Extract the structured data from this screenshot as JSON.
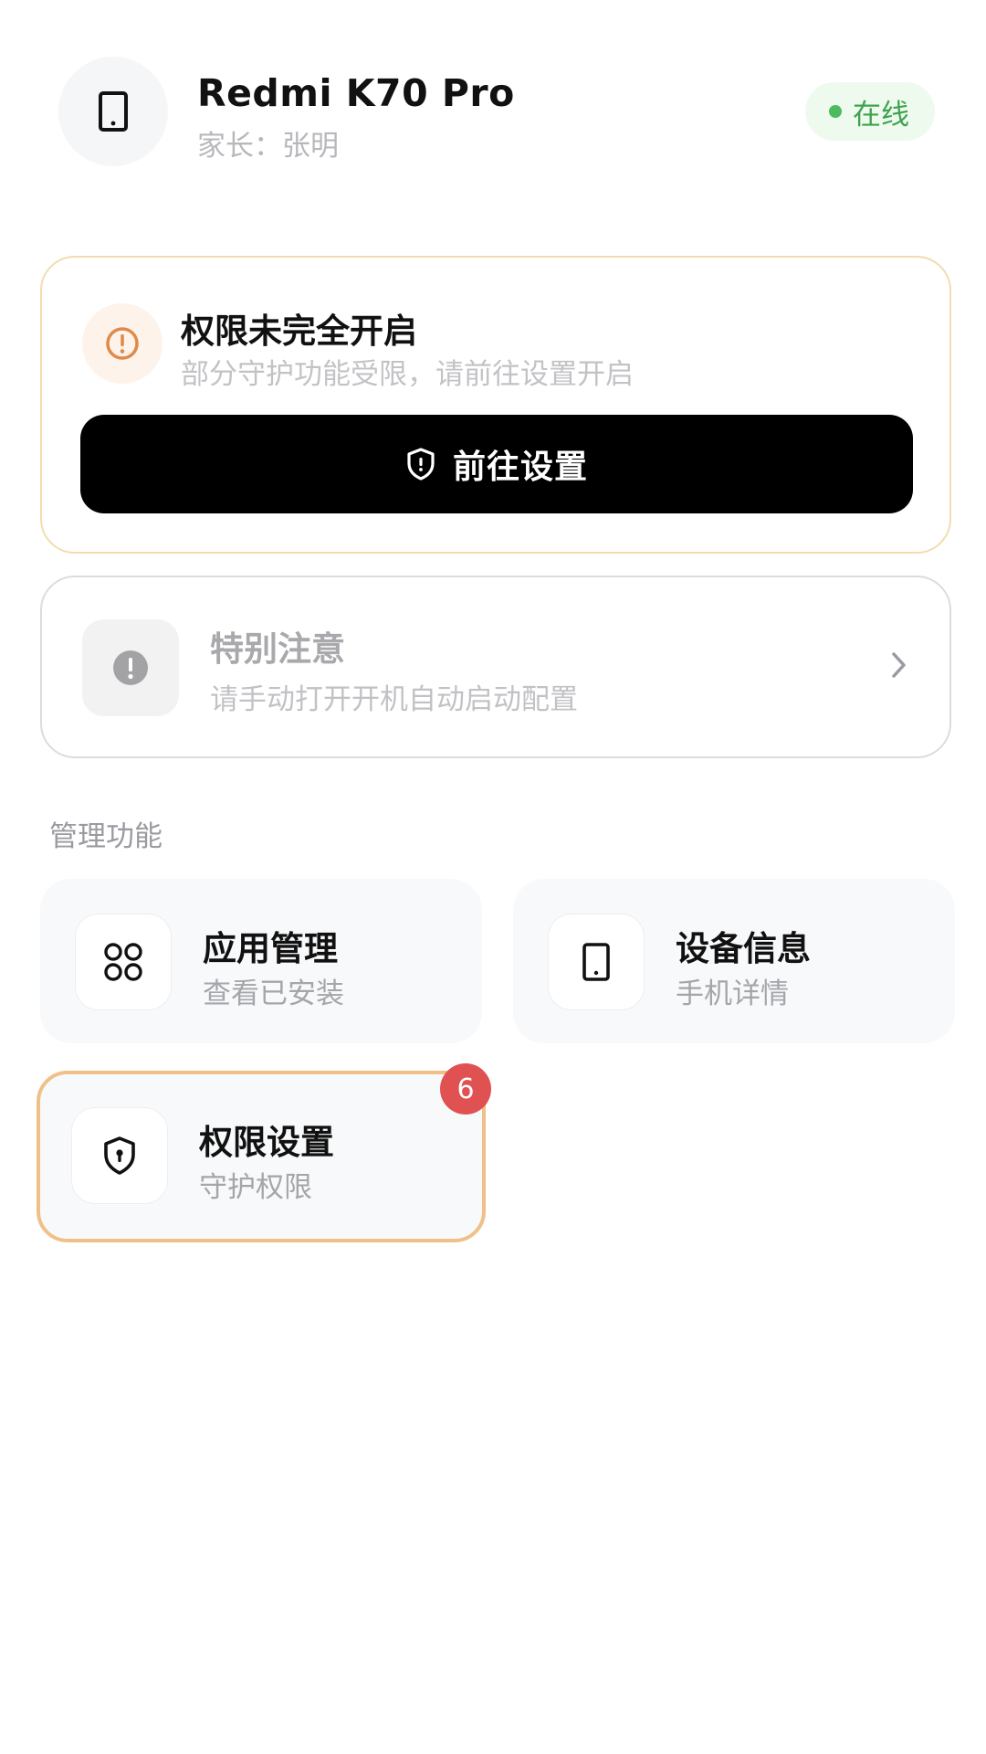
{
  "device": {
    "name": "Redmi K70 Pro",
    "guardian": "家长：张明",
    "status": "在线",
    "icon": "phone-icon"
  },
  "permission_warning": {
    "title": "权限未完全开启",
    "subtitle": "部分守护功能受限，请前往设置开启",
    "button_label": "前往设置",
    "icon": "warning-circle-icon",
    "button_icon": "shield-icon"
  },
  "attention": {
    "title": "特别注意",
    "subtitle": "请手动打开开机自动启动配置",
    "icon": "alert-circle-icon"
  },
  "management": {
    "section_label": "管理功能",
    "tiles": [
      {
        "title": "应用管理",
        "subtitle": "查看已安装",
        "icon": "apps-grid-icon"
      },
      {
        "title": "设备信息",
        "subtitle": "手机详情",
        "icon": "phone-icon"
      },
      {
        "title": "权限设置",
        "subtitle": "守护权限",
        "icon": "shield-icon",
        "badge": "6"
      }
    ]
  },
  "colors": {
    "accent_warning": "#e08a4a",
    "online_green": "#3da24e",
    "badge_red": "#e05252",
    "highlight_border": "#f0c088"
  }
}
